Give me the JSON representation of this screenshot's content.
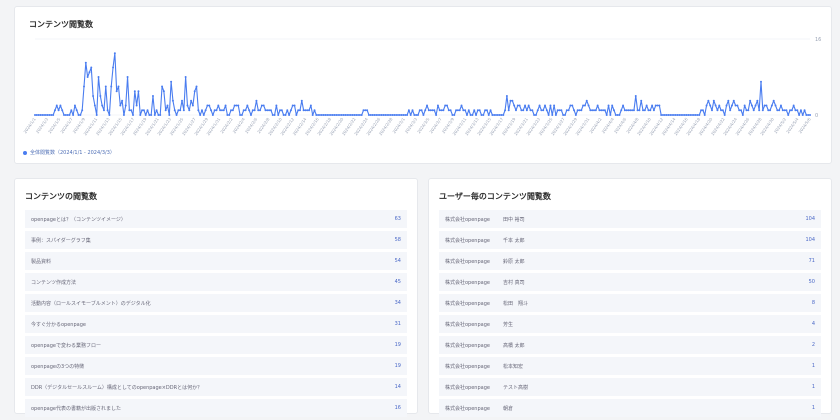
{
  "chart": {
    "title": "コンテンツ閲覧数",
    "legend": "全体閲覧数（2024/1/1 - 2024/3/3）",
    "colors": {
      "line": "#4a7df0",
      "grid": "#e8ebf2",
      "axis": "#9aa3b5"
    }
  },
  "chart_data": {
    "type": "line",
    "title": "コンテンツ閲覧数",
    "ylim": [
      0,
      16
    ],
    "y_ticks": [
      "16",
      "0"
    ],
    "grid": true,
    "legend": "bottom-left",
    "x_ticks": [
      "2024/1/1",
      "2024/1/3",
      "2024/1/5",
      "2024/1/7",
      "2024/1/9",
      "2024/1/11",
      "2024/1/13",
      "2024/1/15",
      "2024/1/17",
      "2024/1/19",
      "2024/1/21",
      "2024/1/23",
      "2024/1/25",
      "2024/1/27",
      "2024/1/29",
      "2024/1/31",
      "2024/2/2",
      "2024/2/4",
      "2024/2/6",
      "2024/2/8",
      "2024/2/10",
      "2024/2/12",
      "2024/2/14",
      "2024/2/16",
      "2024/2/18",
      "2024/2/20",
      "2024/2/22",
      "2024/2/24",
      "2024/2/26",
      "2024/2/28",
      "2024/3/1",
      "2024/3/3",
      "2024/3/5",
      "2024/3/7",
      "2024/3/9",
      "2024/3/11",
      "2024/3/13",
      "2024/3/15",
      "2024/3/17",
      "2024/3/19",
      "2024/3/21",
      "2024/3/23",
      "2024/3/25",
      "2024/3/27",
      "2024/3/29",
      "2024/3/31",
      "2024/4/2",
      "2024/4/4",
      "2024/4/6",
      "2024/4/8",
      "2024/4/10",
      "2024/4/12",
      "2024/4/14",
      "2024/4/16",
      "2024/4/18",
      "2024/4/20",
      "2024/4/22",
      "2024/4/24",
      "2024/4/26",
      "2024/4/28",
      "2024/4/30",
      "2024/5/2",
      "2024/5/4",
      "2024/5/6"
    ],
    "series": [
      {
        "values": [
          0,
          0,
          0,
          0,
          0,
          0,
          0,
          0,
          0,
          0,
          0,
          1,
          2,
          1,
          2,
          1,
          0,
          0,
          0,
          0,
          1,
          0,
          2,
          1,
          0,
          0,
          1,
          6,
          11,
          8,
          9,
          10,
          4,
          2,
          0,
          8,
          4,
          2,
          1,
          6,
          1,
          0,
          6,
          10,
          13,
          5,
          6,
          2,
          3,
          0,
          2,
          8,
          1,
          1,
          0,
          5,
          2,
          5,
          0,
          1,
          1,
          0,
          1,
          0,
          0,
          4,
          0,
          1,
          0,
          0,
          6,
          5,
          1,
          2,
          0,
          7,
          3,
          1,
          0,
          1,
          1,
          3,
          1,
          8,
          2,
          1,
          3,
          2,
          5,
          6,
          1,
          0,
          1,
          0,
          1,
          2,
          2,
          1,
          0,
          1,
          1,
          2,
          1,
          1,
          1,
          2,
          0,
          0,
          1,
          1,
          2,
          2,
          2,
          0,
          0,
          1,
          1,
          2,
          1,
          0,
          1,
          1,
          3,
          1,
          1,
          2,
          2,
          1,
          1,
          1,
          1,
          0,
          0,
          2,
          0,
          1,
          1,
          0,
          0,
          1,
          0,
          1,
          2,
          2,
          0,
          1,
          1,
          3,
          1,
          1,
          1,
          1,
          2,
          0,
          1,
          0,
          0,
          0,
          0,
          0,
          0,
          0,
          0,
          0,
          0,
          0,
          0,
          0,
          0,
          0,
          0,
          0,
          0,
          0,
          0,
          0,
          0,
          0,
          0,
          0,
          0,
          1,
          1,
          1,
          0,
          0,
          0,
          0,
          0,
          0,
          0,
          0,
          0,
          0,
          0,
          0,
          0,
          0,
          0,
          0,
          0,
          0,
          0,
          0,
          0,
          0,
          1,
          0,
          1,
          0,
          0,
          0,
          1,
          1,
          0,
          1,
          2,
          1,
          1,
          1,
          1,
          0,
          2,
          1,
          1,
          1,
          2,
          2,
          1,
          1,
          0,
          0,
          1,
          1,
          1,
          2,
          1,
          1,
          0,
          1,
          0,
          0,
          1,
          0,
          1,
          1,
          0,
          0,
          1,
          1,
          0,
          1,
          0,
          0,
          0,
          0,
          0,
          0,
          0,
          1,
          4,
          1,
          3,
          3,
          2,
          1,
          2,
          2,
          1,
          1,
          2,
          1,
          2,
          1,
          1,
          0,
          0,
          1,
          2,
          1,
          1,
          2,
          1,
          0,
          2,
          0,
          2,
          0,
          1,
          1,
          1,
          0,
          0,
          1,
          1,
          2,
          2,
          1,
          0,
          1,
          1,
          1,
          2,
          2,
          3,
          2,
          1,
          1,
          1,
          1,
          2,
          1,
          1,
          1,
          1,
          0,
          2,
          0,
          2,
          1,
          0,
          0,
          0,
          1,
          2,
          1,
          1,
          1,
          1,
          1,
          1,
          4,
          1,
          1,
          3,
          1,
          1,
          2,
          1,
          1,
          2,
          1,
          2,
          2,
          2,
          0,
          0,
          0,
          0,
          0,
          0,
          0,
          0,
          0,
          0,
          0,
          0,
          0,
          0,
          0,
          0,
          0,
          0,
          0,
          0,
          0,
          0,
          1,
          1,
          0,
          2,
          3,
          2,
          1,
          3,
          2,
          1,
          2,
          1,
          1,
          0,
          2,
          3,
          1,
          2,
          3,
          2,
          2,
          1,
          1,
          0,
          2,
          1,
          1,
          3,
          2,
          1,
          2,
          3,
          1,
          7,
          1,
          2,
          2,
          1,
          1,
          2,
          3,
          2,
          1,
          1,
          2,
          1,
          1,
          1,
          0,
          1,
          1,
          2,
          1,
          1,
          0,
          1,
          0,
          1,
          0,
          0,
          0
        ]
      }
    ]
  },
  "left_panel": {
    "title": "コンテンツの閲覧数",
    "rows": [
      {
        "name": "openpageとは？（コンテンツイメージ）",
        "count": "63"
      },
      {
        "name": "事例：スパイダーグラフ集",
        "count": "58"
      },
      {
        "name": "製品資料",
        "count": "54"
      },
      {
        "name": "コンテンツ作成方法",
        "count": "45"
      },
      {
        "name": "活動内容（ロールスイモーブルメント）のデジタル化",
        "count": "34"
      },
      {
        "name": "今すぐ分かるopenpage",
        "count": "31"
      },
      {
        "name": "openpageで変わる業務フロー",
        "count": "19"
      },
      {
        "name": "openpageの3つの特徴",
        "count": "19"
      },
      {
        "name": "DDR（デジタルセールスルーム）構成としてのopenpage×DDRとは何か？",
        "count": "14"
      },
      {
        "name": "openpage代表の書籍が出版されました",
        "count": "16"
      }
    ]
  },
  "right_panel": {
    "title": "ユーザー毎のコンテンツ閲覧数",
    "rows": [
      {
        "org": "株式会社openpage",
        "user": "田中 裕司",
        "count": "104"
      },
      {
        "org": "株式会社openpage",
        "user": "千本 太郎",
        "count": "104"
      },
      {
        "org": "株式会社openpage",
        "user": "鈴原 太郎",
        "count": "71"
      },
      {
        "org": "株式会社openpage",
        "user": "吉村 真司",
        "count": "50"
      },
      {
        "org": "株式会社openpage",
        "user": "松田　翔斗",
        "count": "8"
      },
      {
        "org": "株式会社openpage",
        "user": "芳生",
        "count": "4"
      },
      {
        "org": "株式会社openpage",
        "user": "高橋 太郎",
        "count": "2"
      },
      {
        "org": "株式会社openpage",
        "user": "松本知宏",
        "count": "1"
      },
      {
        "org": "株式会社openpage",
        "user": "テスト高樹",
        "count": "1"
      },
      {
        "org": "株式会社openpage",
        "user": "朝倉",
        "count": "1"
      }
    ]
  }
}
